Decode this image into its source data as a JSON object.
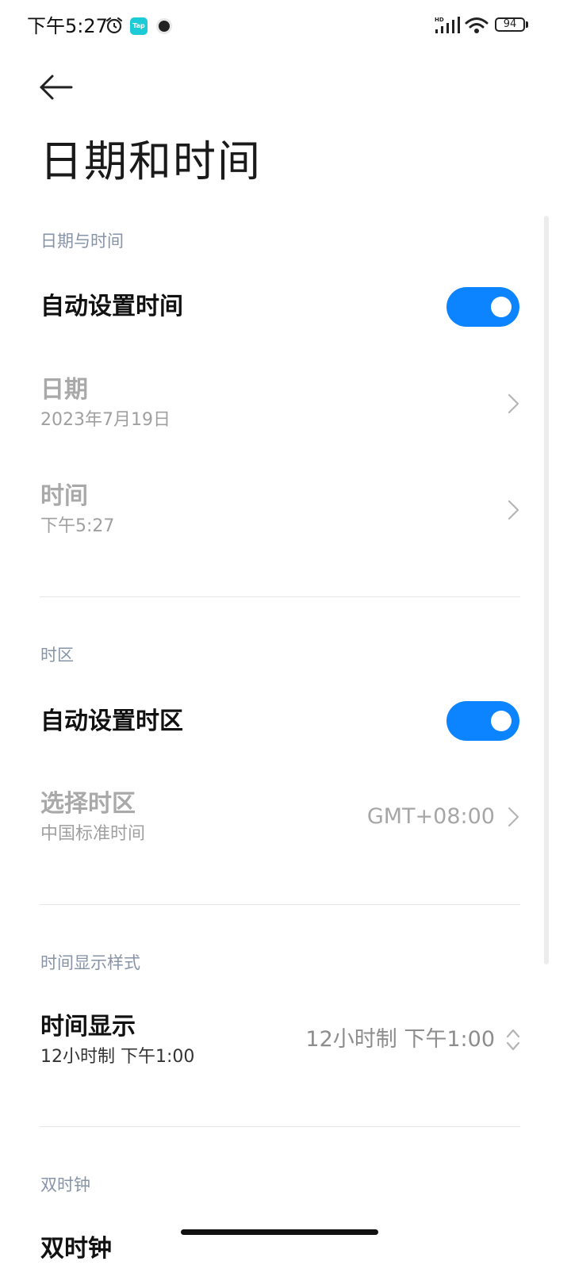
{
  "status_bar": {
    "time": "下午5:27",
    "tap_badge": "Tap",
    "battery": "94",
    "icons": [
      "alarm-icon",
      "tap-app-icon",
      "dot-icon",
      "hd-signal-icon",
      "wifi-icon",
      "battery-icon"
    ]
  },
  "header": {
    "back_icon": "arrow-left-icon",
    "title": "日期和时间"
  },
  "sections": {
    "datetime": {
      "header": "日期与时间",
      "auto_time": {
        "label": "自动设置时间",
        "enabled": true
      },
      "date": {
        "label": "日期",
        "value": "2023年7月19日"
      },
      "time": {
        "label": "时间",
        "value": "下午5:27"
      }
    },
    "timezone": {
      "header": "时区",
      "auto_zone": {
        "label": "自动设置时区",
        "enabled": true
      },
      "select_zone": {
        "label": "选择时区",
        "sub": "中国标准时间",
        "value": "GMT+08:00"
      }
    },
    "format": {
      "header": "时间显示样式",
      "display": {
        "label": "时间显示",
        "sub": "12小时制 下午1:00",
        "value": "12小时制 下午1:00"
      }
    },
    "dual_clock": {
      "header": "双时钟",
      "item_label": "双时钟"
    }
  },
  "colors": {
    "accent": "#0d84ff",
    "section_header": "#8794a8",
    "disabled_text": "#a9a9a9"
  }
}
